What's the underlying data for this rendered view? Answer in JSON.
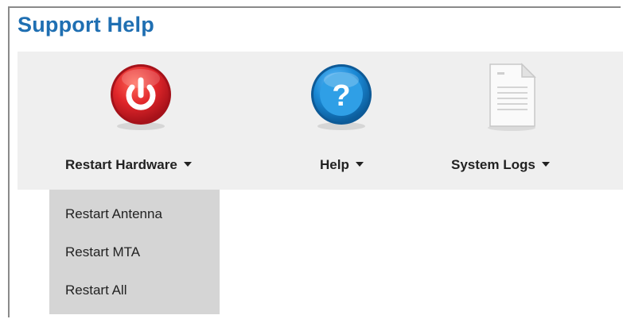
{
  "page": {
    "title": "Support Help"
  },
  "toolbar": {
    "items": [
      {
        "label": "Restart Hardware",
        "icon": "power-icon",
        "color": "#d8262a"
      },
      {
        "label": "Help",
        "icon": "help-icon",
        "color": "#1b8ad6"
      },
      {
        "label": "System Logs",
        "icon": "document-icon",
        "color": "#e8e8e8"
      }
    ]
  },
  "dropdown": {
    "items": [
      {
        "label": "Restart Antenna"
      },
      {
        "label": "Restart MTA"
      },
      {
        "label": "Restart All"
      }
    ]
  },
  "colors": {
    "title": "#1f6fb2",
    "toolbar_bg": "#efefef",
    "dropdown_bg": "#d5d5d5"
  }
}
